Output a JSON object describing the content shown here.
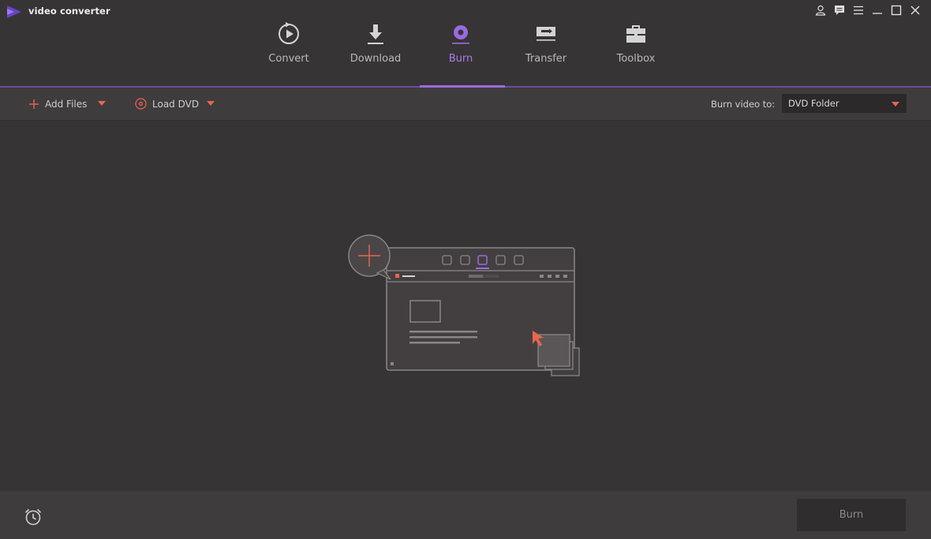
{
  "app": {
    "title": "video converter",
    "brand_color": "#7b4fd1",
    "accent_color": "#e8664f",
    "active_tab_color": "#a879e8"
  },
  "window_controls": [
    {
      "name": "account-icon"
    },
    {
      "name": "feedback-icon"
    },
    {
      "name": "menu-icon"
    },
    {
      "name": "minimize-icon"
    },
    {
      "name": "maximize-icon"
    },
    {
      "name": "close-icon"
    }
  ],
  "tabs": [
    {
      "label": "Convert",
      "icon": "convert-icon",
      "active": false
    },
    {
      "label": "Download",
      "icon": "download-icon",
      "active": false
    },
    {
      "label": "Burn",
      "icon": "burn-disc-icon",
      "active": true
    },
    {
      "label": "Transfer",
      "icon": "transfer-icon",
      "active": false
    },
    {
      "label": "Toolbox",
      "icon": "toolbox-icon",
      "active": false
    }
  ],
  "toolbar": {
    "add_files_label": "Add Files",
    "load_dvd_label": "Load DVD",
    "burn_to_label": "Burn video to:",
    "burn_to_value": "DVD Folder"
  },
  "content": {
    "placeholder_icon": "add-files-illustration-icon"
  },
  "footer": {
    "schedule_icon": "alarm-clock-icon",
    "burn_button_label": "Burn",
    "burn_button_enabled": false
  }
}
